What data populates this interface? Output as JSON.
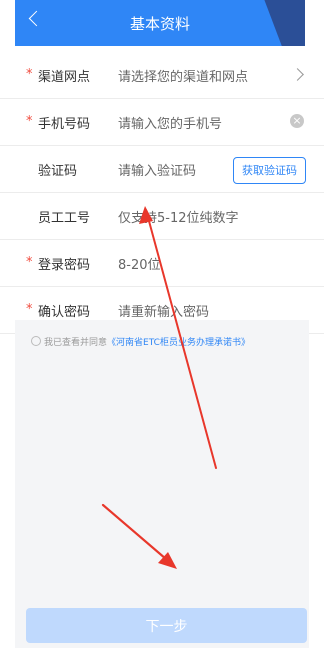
{
  "header": {
    "title": "基本资料",
    "back_icon": "chevron-left-icon"
  },
  "form": {
    "rows": [
      {
        "required": true,
        "label": "渠道网点",
        "placeholder": "请选择您的渠道和网点",
        "trailing": "chevron-right-icon"
      },
      {
        "required": true,
        "label": "手机号码",
        "placeholder": "请输入您的手机号",
        "trailing": "clear-icon"
      },
      {
        "required": false,
        "label": "验证码",
        "placeholder": "请输入验证码",
        "button": "获取验证码"
      },
      {
        "required": false,
        "label": "员工工号",
        "placeholder": "仅支持5-12位纯数字"
      },
      {
        "required": true,
        "label": "登录密码",
        "placeholder": "8-20位"
      },
      {
        "required": true,
        "label": "确认密码",
        "placeholder": "请重新输入密码"
      }
    ],
    "required_mark": "*"
  },
  "agreement": {
    "prefix": "我已查看并同意",
    "link_text": "《河南省ETC柜员业务办理承诺书》"
  },
  "footer": {
    "next_label": "下一步"
  },
  "colors": {
    "primary": "#2f86f6",
    "dark_accent": "#2b4f97",
    "required": "#f04a3d",
    "disabled_button": "#bfd9fd",
    "annotation_arrow": "#e8372b"
  }
}
